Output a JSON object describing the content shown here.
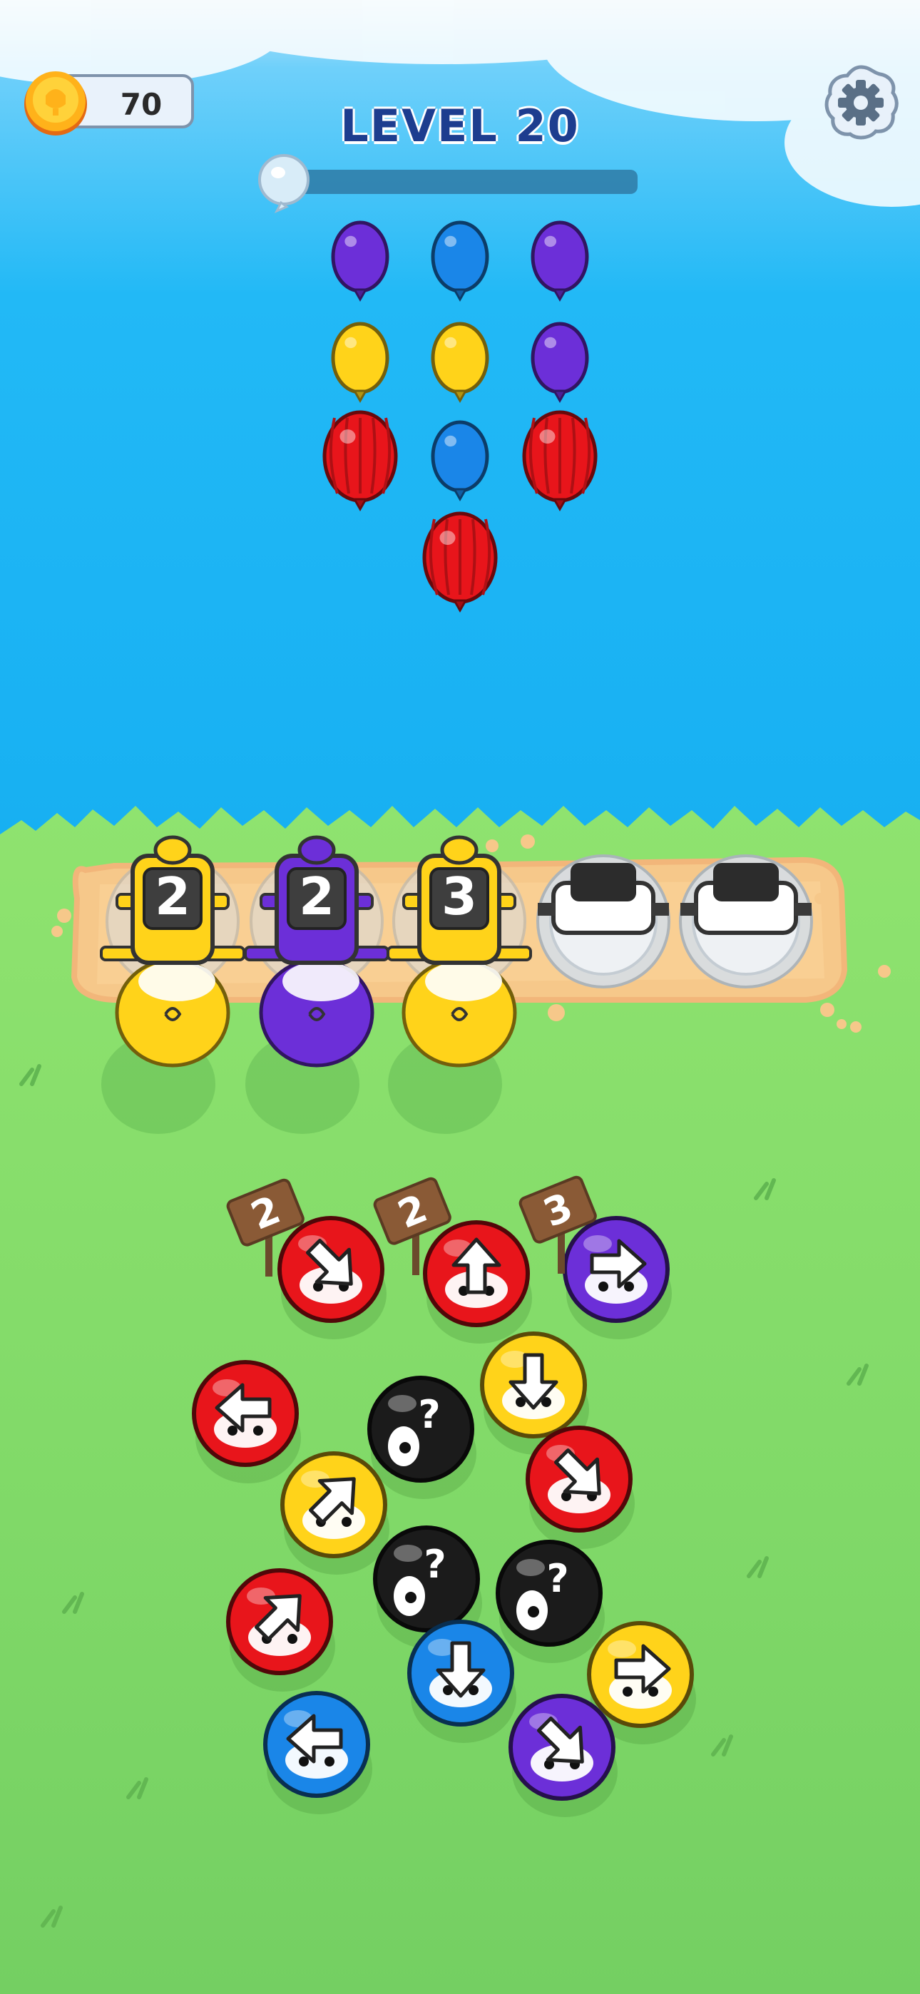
{
  "hud": {
    "coins": "70",
    "level_label": "LEVEL 20",
    "level_progress": 0.0,
    "settings_icon": "gear-icon",
    "coin_icon": "coin-icon"
  },
  "colors": {
    "sky_top": "#bfe4f6",
    "sky_bottom": "#1fb4f3",
    "grass": "#84dc68",
    "red": "#e8151b",
    "blue": "#1a86e8",
    "purple": "#6c2fd8",
    "yellow": "#ffd31a",
    "black": "#1b1b1b"
  },
  "target_balloons": [
    {
      "row": 1,
      "col": 1,
      "color": "purple"
    },
    {
      "row": 1,
      "col": 2,
      "color": "blue"
    },
    {
      "row": 1,
      "col": 3,
      "color": "purple"
    },
    {
      "row": 2,
      "col": 1,
      "color": "yellow"
    },
    {
      "row": 2,
      "col": 2,
      "color": "yellow"
    },
    {
      "row": 2,
      "col": 3,
      "color": "purple"
    },
    {
      "row": 3,
      "col": 1,
      "color": "red",
      "striped": true
    },
    {
      "row": 3,
      "col": 2,
      "color": "blue"
    },
    {
      "row": 3,
      "col": 3,
      "color": "red",
      "striped": true
    },
    {
      "row": 4,
      "col": 2,
      "color": "red",
      "striped": true
    }
  ],
  "shooter_slots": [
    {
      "slot": 1,
      "color": "yellow",
      "ammo": "2"
    },
    {
      "slot": 2,
      "color": "purple",
      "ammo": "2"
    },
    {
      "slot": 3,
      "color": "yellow",
      "ammo": "3"
    },
    {
      "slot": 4,
      "color": "empty",
      "ammo": ""
    },
    {
      "slot": 5,
      "color": "empty",
      "ammo": ""
    }
  ],
  "front_signs": [
    "2",
    "2",
    "3"
  ],
  "pieces": [
    {
      "id": 1,
      "color": "red",
      "arrow": "down-right"
    },
    {
      "id": 2,
      "color": "red",
      "arrow": "up"
    },
    {
      "id": 3,
      "color": "purple",
      "arrow": "right"
    },
    {
      "id": 4,
      "color": "red",
      "arrow": "left"
    },
    {
      "id": 5,
      "color": "black",
      "arrow": "hidden"
    },
    {
      "id": 6,
      "color": "yellow",
      "arrow": "down"
    },
    {
      "id": 7,
      "color": "yellow",
      "arrow": "up-right"
    },
    {
      "id": 8,
      "color": "red",
      "arrow": "down-right"
    },
    {
      "id": 9,
      "color": "black",
      "arrow": "hidden"
    },
    {
      "id": 10,
      "color": "black",
      "arrow": "hidden"
    },
    {
      "id": 11,
      "color": "red",
      "arrow": "up-right"
    },
    {
      "id": 12,
      "color": "yellow",
      "arrow": "right"
    },
    {
      "id": 13,
      "color": "blue",
      "arrow": "down"
    },
    {
      "id": 14,
      "color": "blue",
      "arrow": "left"
    },
    {
      "id": 15,
      "color": "purple",
      "arrow": "down-right"
    }
  ]
}
